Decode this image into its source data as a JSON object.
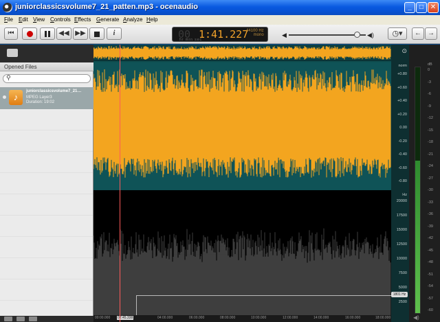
{
  "window": {
    "title": "juniorclassicsvolume7_21_patten.mp3 - ocenaudio",
    "buttons": [
      "_",
      "□",
      "✕"
    ]
  },
  "menu": [
    "File",
    "Edit",
    "View",
    "Controls",
    "Effects",
    "Generate",
    "Analyze",
    "Help"
  ],
  "toolbar": {
    "time_dim": "00",
    "time": "1:41.227",
    "sample_rate": "44100 Hz",
    "channels": "mono",
    "time_units": "hr  min  sec",
    "volume_level": 0.85,
    "info_label": "i"
  },
  "sidebar": {
    "header": "Opened Files",
    "search_placeholder": "",
    "file": {
      "name": "juniorclassicsvolume7_21…",
      "format": "MPEG Layer3",
      "duration": "Duration: 19:02"
    }
  },
  "amplitude_axis": {
    "unit": "norm",
    "ticks": [
      "+0.80",
      "+0.60",
      "+0.40",
      "+0.20",
      "0.00",
      "-0.20",
      "-0.40",
      "-0.60",
      "-0.80"
    ]
  },
  "frequency_axis": {
    "unit": "Hz",
    "ticks": [
      "20000",
      "17500",
      "15000",
      "12500",
      "10000",
      "7500",
      "5000",
      "2500"
    ],
    "cursor_label": "1801 Hz"
  },
  "meter": {
    "unit": "dB",
    "ticks": [
      "0",
      "-3",
      "-6",
      "-9",
      "-12",
      "-15",
      "-18",
      "-21",
      "-24",
      "-27",
      "-30",
      "-33",
      "-36",
      "-39",
      "-42",
      "-45",
      "-48",
      "-51",
      "-54",
      "-57",
      "-60"
    ],
    "level_fraction": 0.62
  },
  "timeline": {
    "labels": [
      "00:00.000",
      "02:45.338",
      "04:00.000",
      "06:00.000",
      "08:00.000",
      "10:00.000",
      "12:00.000",
      "14:00.000",
      "16:00.000",
      "18:00.000"
    ]
  },
  "colors": {
    "waveform": "#f3a51f",
    "wave_bg": "#0f5357",
    "spectrogram_bg": "#000000",
    "playhead": "#ff5a5a",
    "meter_fill": "#4faa3c"
  }
}
